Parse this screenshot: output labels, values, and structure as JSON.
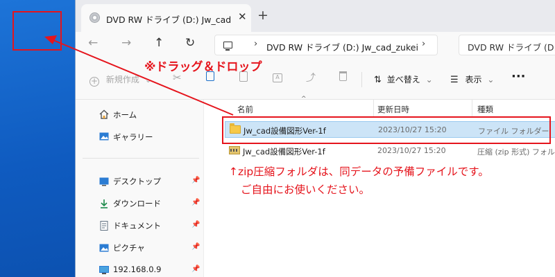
{
  "window": {
    "tab_title": "DVD RW ドライブ (D:) Jw_cad_zukei",
    "tab_close": "✕",
    "new_tab": "+"
  },
  "nav": {
    "back": "←",
    "forward": "→",
    "up": "↑",
    "refresh": "↻",
    "crumb_sep": "›",
    "crumb_sep_end": "›",
    "address_text": "DVD RW ドライブ (D:) Jw_cad_zukei",
    "search_text": "DVD RW ドライブ (D:) を検索"
  },
  "toolbar": {
    "new_label": "新規作成",
    "sort_label": "並べ替え",
    "view_label": "表示",
    "more_label": "···",
    "chevron": "⌄"
  },
  "sidebar": {
    "items": [
      {
        "label": "ホーム"
      },
      {
        "label": "ギャラリー"
      },
      {
        "label": "デスクトップ",
        "pin": "📌"
      },
      {
        "label": "ダウンロード",
        "pin": "📌"
      },
      {
        "label": "ドキュメント",
        "pin": "📌"
      },
      {
        "label": "ピクチャ",
        "pin": "📌"
      },
      {
        "label": "192.168.0.9",
        "pin": "📌"
      }
    ]
  },
  "content": {
    "columns": {
      "name": "名前",
      "date": "更新日時",
      "type": "種類"
    },
    "sort_indicator": "^",
    "rows": [
      {
        "name": "Jw_cad設備図形Ver-1f",
        "date": "2023/10/27 15:20",
        "type": "ファイル フォルダー",
        "icon": "folder-icon",
        "selected": true
      },
      {
        "name": "Jw_cad設備図形Ver-1f",
        "date": "2023/10/27 15:20",
        "type": "圧縮 (zip 形式) フォルダー",
        "icon": "zip-folder-icon",
        "selected": false
      }
    ]
  },
  "annotations": {
    "drag_drop": "※ドラッグ＆ドロップ",
    "note_line1": "↑zip圧縮フォルダは、同データの予備ファイルです。",
    "note_line2": "ご自由にお使いください。",
    "color": "#e5141c"
  }
}
